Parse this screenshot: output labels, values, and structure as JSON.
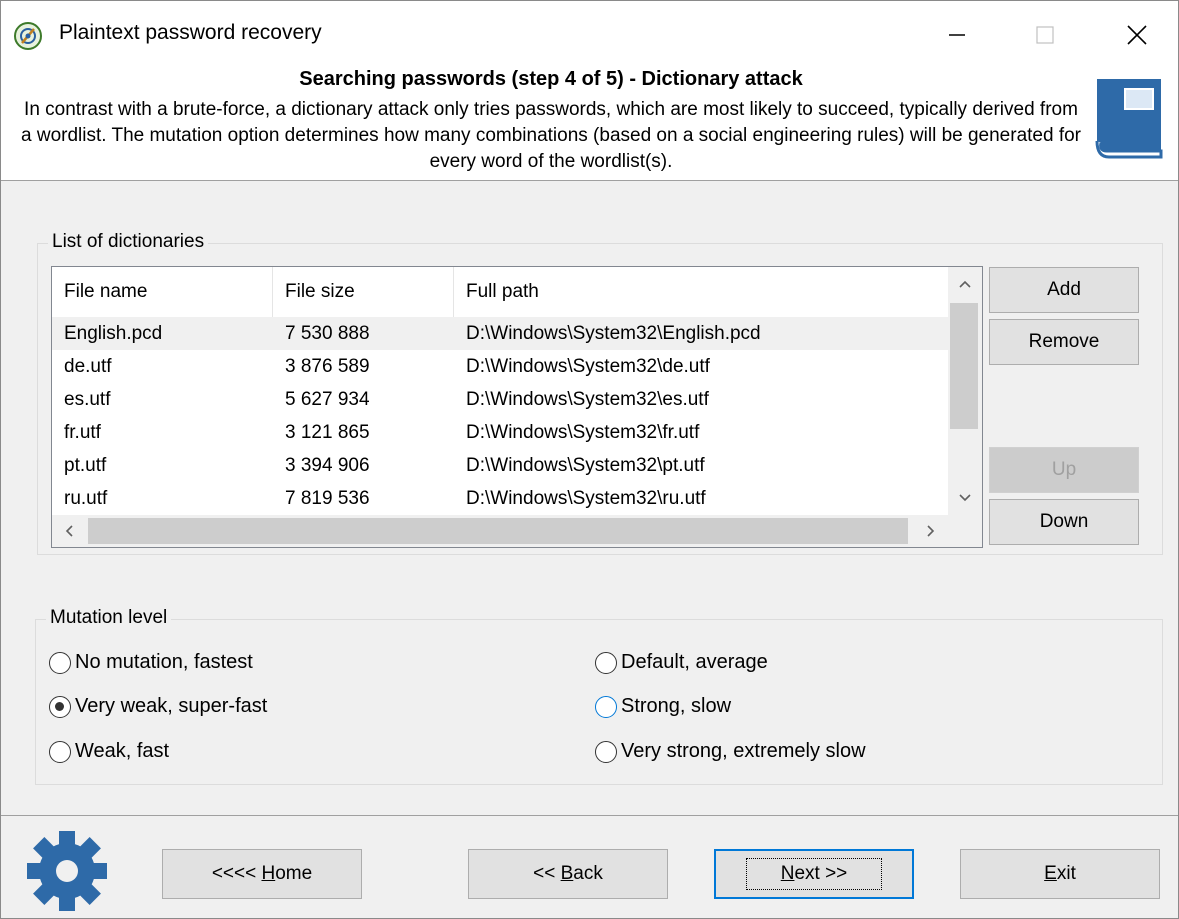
{
  "window": {
    "title": "Plaintext password recovery",
    "icons": {
      "app": "app-icon",
      "minimize": "minimize-icon",
      "maximize": "maximize-icon",
      "close": "close-icon"
    }
  },
  "header": {
    "title": "Searching passwords (step 4 of 5) - Dictionary attack",
    "description": "In contrast with a brute-force, a dictionary attack only tries passwords, which are most likely to succeed, typically derived from a wordlist. The mutation option determines how many combinations (based on a social engineering rules)  will be generated for every word of the wordlist(s).",
    "icon": "book-icon"
  },
  "dictionaries": {
    "legend": "List of dictionaries",
    "columns": [
      "File name",
      "File size",
      "Full path"
    ],
    "rows": [
      {
        "name": "English.pcd",
        "size": "7 530 888",
        "path": "D:\\Windows\\System32\\English.pcd"
      },
      {
        "name": "de.utf",
        "size": "3 876 589",
        "path": "D:\\Windows\\System32\\de.utf"
      },
      {
        "name": "es.utf",
        "size": "5 627 934",
        "path": "D:\\Windows\\System32\\es.utf"
      },
      {
        "name": "fr.utf",
        "size": "3 121 865",
        "path": "D:\\Windows\\System32\\fr.utf"
      },
      {
        "name": "pt.utf",
        "size": "3 394 906",
        "path": "D:\\Windows\\System32\\pt.utf"
      },
      {
        "name": "ru.utf",
        "size": "7 819 536",
        "path": "D:\\Windows\\System32\\ru.utf"
      }
    ],
    "buttons": {
      "add": "Add",
      "remove": "Remove",
      "up": "Up",
      "down": "Down"
    }
  },
  "mutation": {
    "legend": "Mutation level",
    "options": [
      "No mutation, fastest",
      "Very weak, super-fast",
      "Weak, fast",
      "Default, average",
      "Strong, slow",
      "Very strong, extremely slow"
    ],
    "selected": "Very weak, super-fast"
  },
  "footer": {
    "icon": "gear-icon",
    "home": {
      "text": "<<<< ",
      "key": "H",
      "rest": "ome"
    },
    "back": {
      "text": "<< ",
      "key": "B",
      "rest": "ack"
    },
    "next": {
      "key": "N",
      "rest": "ext >>"
    },
    "exit": {
      "key": "E",
      "rest": "xit"
    }
  },
  "colors": {
    "accent": "#0078d7",
    "icon_blue": "#2e6aa8"
  }
}
